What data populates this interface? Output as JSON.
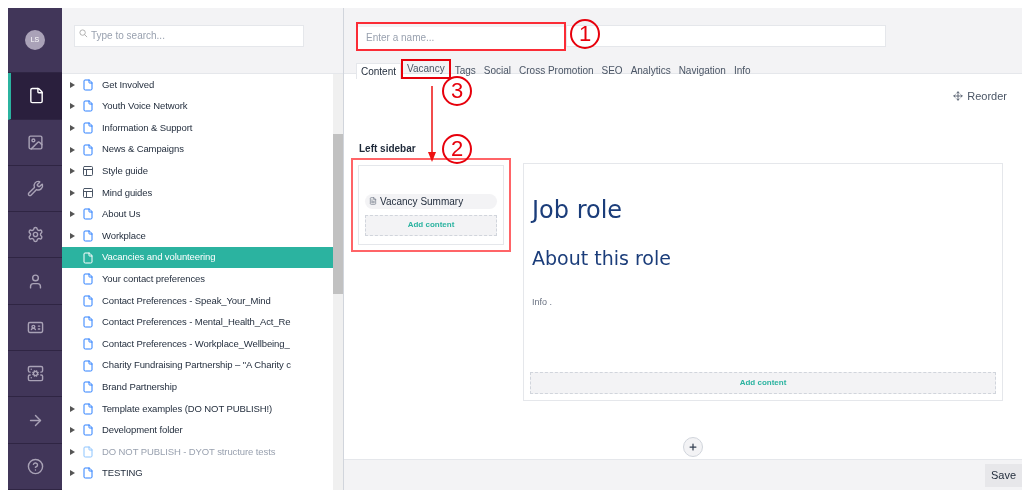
{
  "rail": {
    "avatar": "LS",
    "items": [
      {
        "kind": "content",
        "selected": true
      },
      {
        "kind": "media",
        "selected": false
      },
      {
        "kind": "settings",
        "selected": false
      },
      {
        "kind": "developer",
        "selected": false
      },
      {
        "kind": "users",
        "selected": false
      },
      {
        "kind": "members",
        "selected": false
      },
      {
        "kind": "forms",
        "selected": false
      },
      {
        "kind": "redirect",
        "selected": false
      },
      {
        "kind": "help",
        "selected": false
      }
    ]
  },
  "tree": {
    "search": {
      "placeholder": "Type to search..."
    },
    "items": [
      {
        "label": "Get Involved",
        "kind": "page",
        "expandable": true,
        "selected": false,
        "unpublished": false
      },
      {
        "label": "Youth Voice Network",
        "kind": "page",
        "expandable": true,
        "selected": false,
        "unpublished": false
      },
      {
        "label": "Information & Support",
        "kind": "page",
        "expandable": true,
        "selected": false,
        "unpublished": false
      },
      {
        "label": "News & Campaigns",
        "kind": "page",
        "expandable": true,
        "selected": false,
        "unpublished": false
      },
      {
        "label": "Style guide",
        "kind": "layout",
        "expandable": true,
        "selected": false,
        "unpublished": false
      },
      {
        "label": "Mind guides",
        "kind": "layout",
        "expandable": true,
        "selected": false,
        "unpublished": false
      },
      {
        "label": "About Us",
        "kind": "page",
        "expandable": true,
        "selected": false,
        "unpublished": false
      },
      {
        "label": "Workplace",
        "kind": "page",
        "expandable": true,
        "selected": false,
        "unpublished": false
      },
      {
        "label": "Vacancies and volunteering",
        "kind": "page",
        "expandable": false,
        "selected": true,
        "unpublished": false
      },
      {
        "label": "Your contact preferences",
        "kind": "page",
        "expandable": false,
        "selected": false,
        "unpublished": false
      },
      {
        "label": "Contact Preferences - Speak_Your_Mind",
        "kind": "page",
        "expandable": false,
        "selected": false,
        "unpublished": false
      },
      {
        "label": "Contact Preferences - Mental_Health_Act_Re",
        "kind": "page",
        "expandable": false,
        "selected": false,
        "unpublished": false
      },
      {
        "label": "Contact Preferences - Workplace_Wellbeing_",
        "kind": "page",
        "expandable": false,
        "selected": false,
        "unpublished": false
      },
      {
        "label": "Charity Fundraising Partnership – \"A Charity c",
        "kind": "page",
        "expandable": false,
        "selected": false,
        "unpublished": false
      },
      {
        "label": "Brand Partnership",
        "kind": "page",
        "expandable": false,
        "selected": false,
        "unpublished": false
      },
      {
        "label": "Template examples (DO NOT PUBLISH!)",
        "kind": "page",
        "expandable": true,
        "selected": false,
        "unpublished": false
      },
      {
        "label": "Development folder",
        "kind": "page",
        "expandable": true,
        "selected": false,
        "unpublished": false
      },
      {
        "label": "DO NOT PUBLISH - DYOT structure tests",
        "kind": "page",
        "expandable": true,
        "selected": false,
        "unpublished": true
      },
      {
        "label": "TESTING",
        "kind": "page",
        "expandable": true,
        "selected": false,
        "unpublished": false
      }
    ]
  },
  "editor": {
    "name": {
      "placeholder": "Enter a name..."
    },
    "tabs": [
      {
        "label": "Content",
        "selected": true
      },
      {
        "label": "Vacancy",
        "selected": false
      },
      {
        "label": "Tags",
        "selected": false
      },
      {
        "label": "Social",
        "selected": false
      },
      {
        "label": "Cross Promotion",
        "selected": false
      },
      {
        "label": "SEO",
        "selected": false
      },
      {
        "label": "Analytics",
        "selected": false
      },
      {
        "label": "Navigation",
        "selected": false
      },
      {
        "label": "Info",
        "selected": false
      }
    ],
    "reorder": "Reorder",
    "section_title": "Left sidebar",
    "sidebar_card": {
      "block": "Vacancy Summary",
      "add": "Add content"
    },
    "main_card": {
      "heading": "Job role",
      "subheading": "About this role",
      "text": "Info .",
      "add": "Add content"
    },
    "save": "Save"
  },
  "annotations": [
    {
      "label": "1"
    },
    {
      "label": "2"
    },
    {
      "label": "3"
    }
  ]
}
